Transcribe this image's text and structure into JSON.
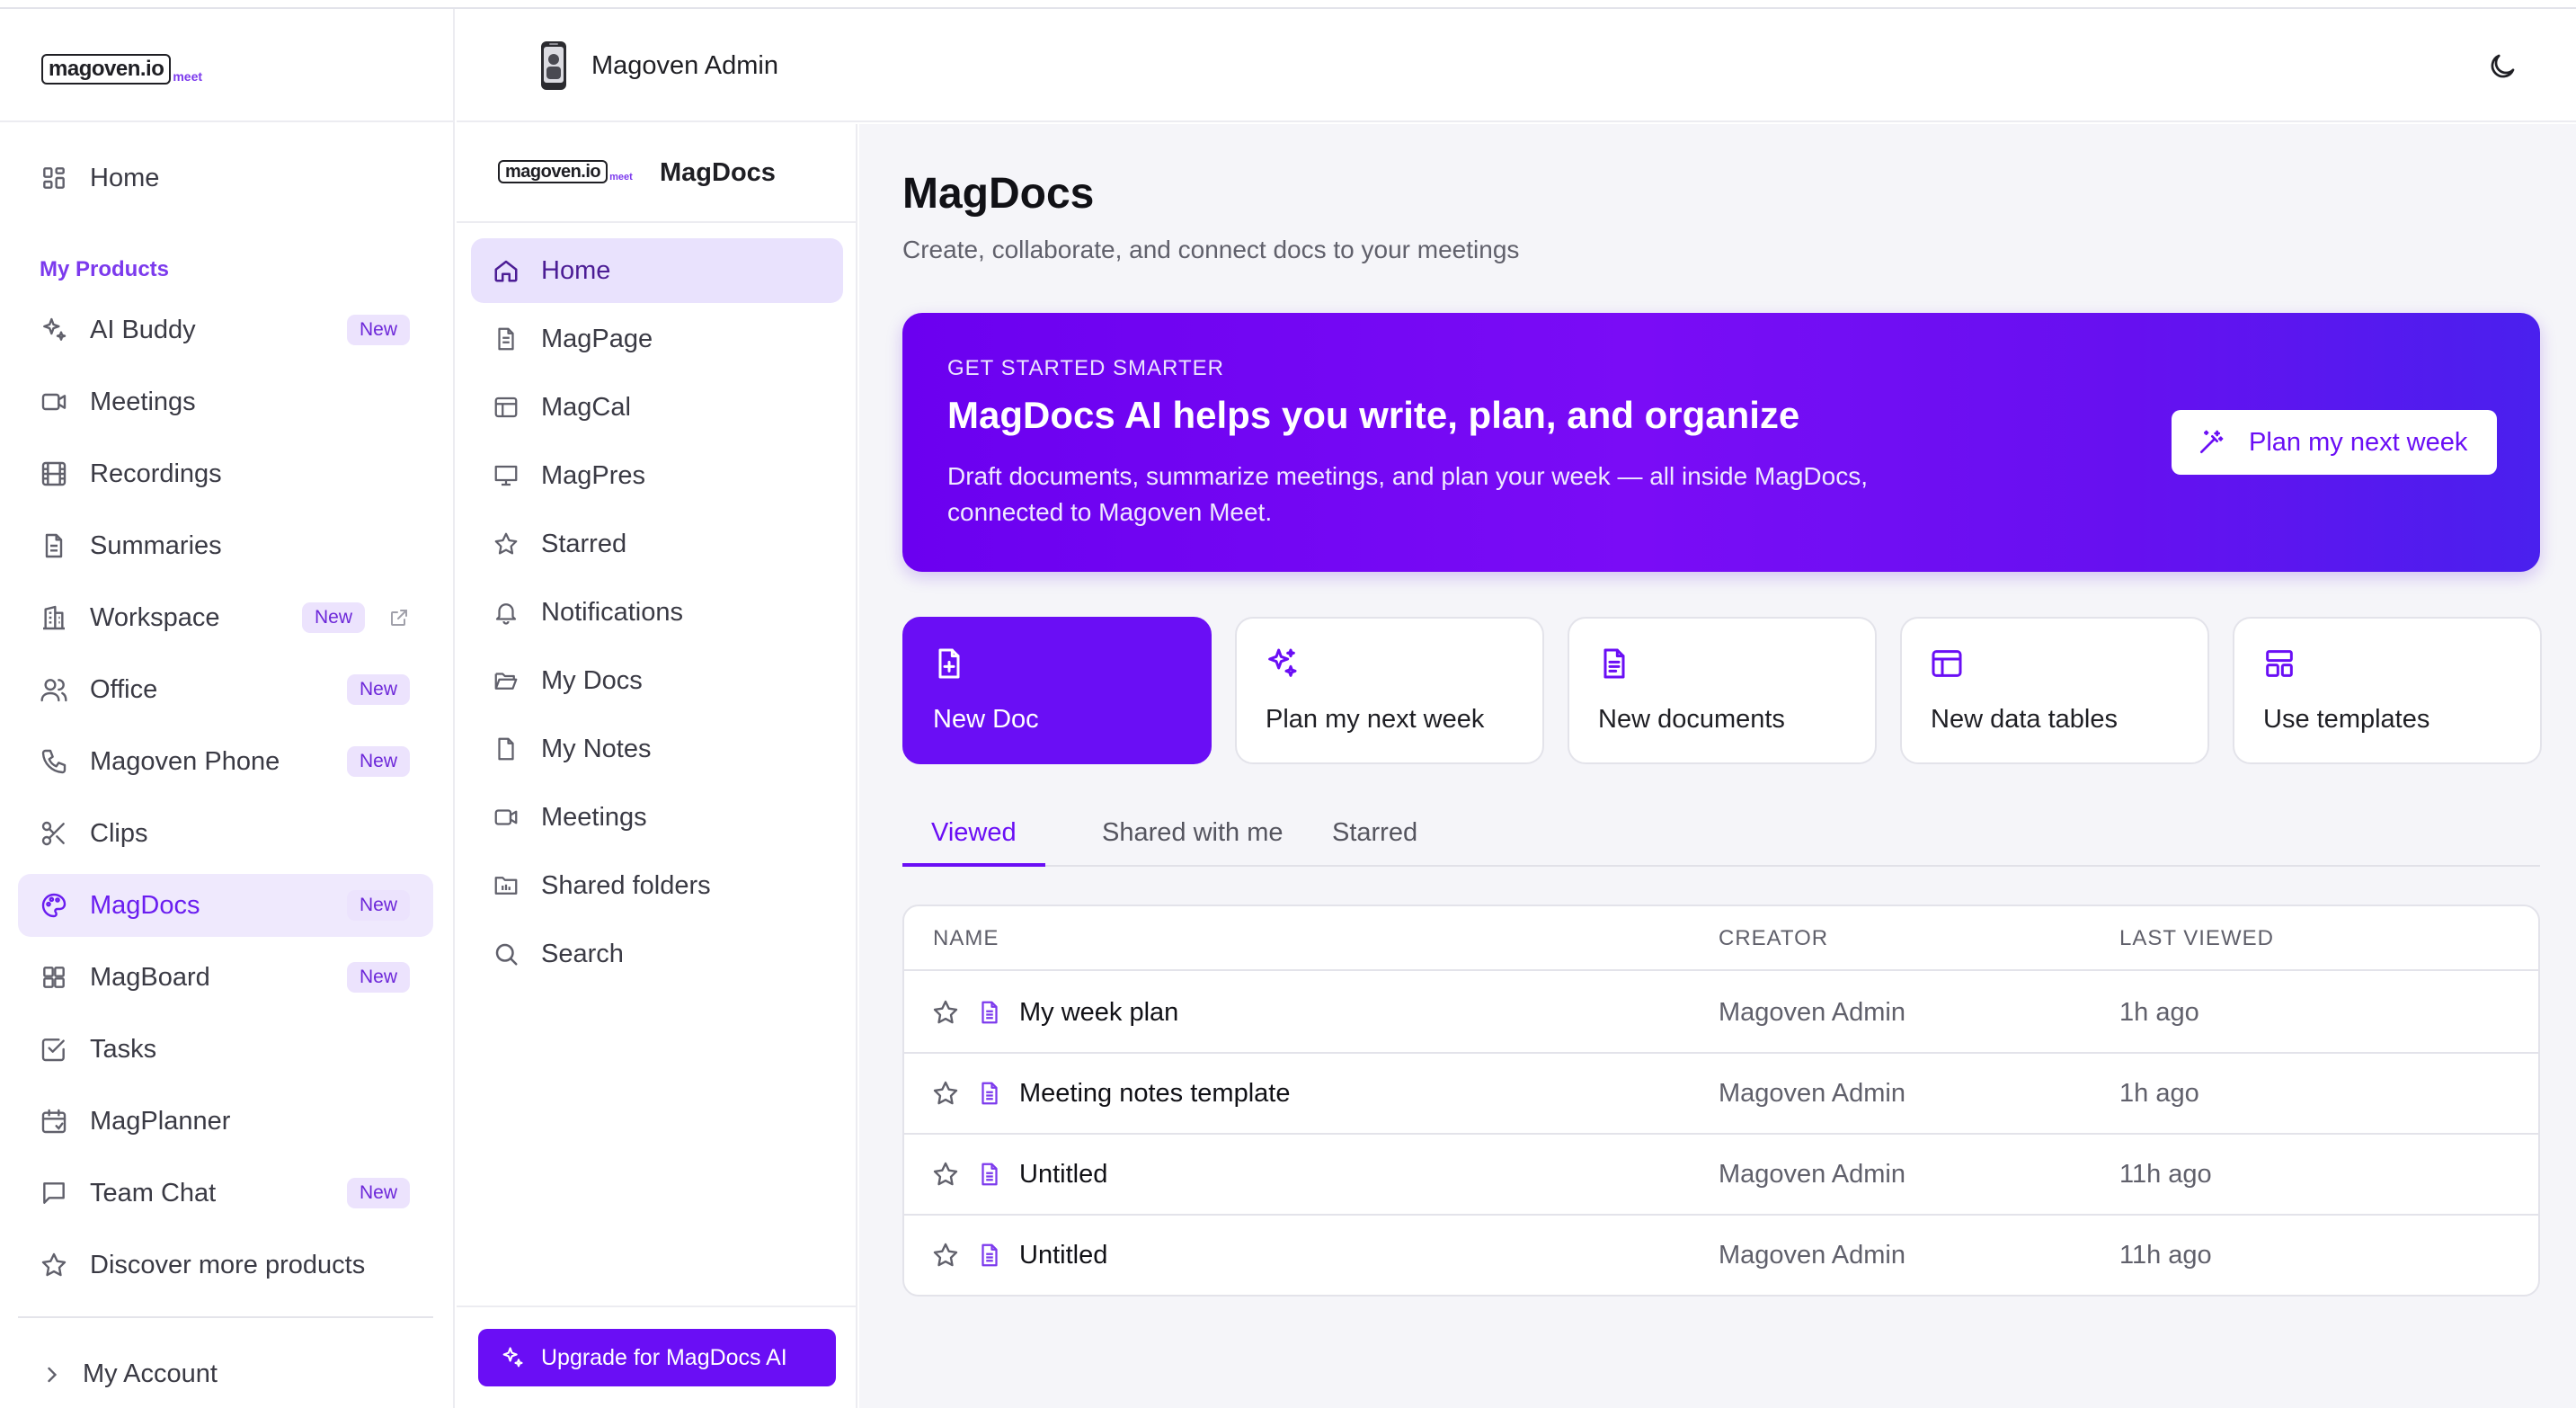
{
  "brand": {
    "logo_text": "magoven.io",
    "logo_suffix": "meet"
  },
  "topbar": {
    "user_name": "Magoven Admin"
  },
  "sidebar": {
    "home_label": "Home",
    "section_title": "My Products",
    "items": [
      {
        "label": "AI Buddy",
        "badge": "New"
      },
      {
        "label": "Meetings",
        "badge": ""
      },
      {
        "label": "Recordings",
        "badge": ""
      },
      {
        "label": "Summaries",
        "badge": ""
      },
      {
        "label": "Workspace",
        "badge": "New"
      },
      {
        "label": "Office",
        "badge": "New"
      },
      {
        "label": "Magoven Phone",
        "badge": "New"
      },
      {
        "label": "Clips",
        "badge": ""
      },
      {
        "label": "MagDocs",
        "badge": "New"
      },
      {
        "label": "MagBoard",
        "badge": "New"
      },
      {
        "label": "Tasks",
        "badge": ""
      },
      {
        "label": "MagPlanner",
        "badge": ""
      },
      {
        "label": "Team Chat",
        "badge": "New"
      },
      {
        "label": "Discover more products",
        "badge": ""
      }
    ],
    "account_label": "My Account"
  },
  "docs_nav": {
    "title": "MagDocs",
    "items": [
      {
        "label": "Home"
      },
      {
        "label": "MagPage"
      },
      {
        "label": "MagCal"
      },
      {
        "label": "MagPres"
      },
      {
        "label": "Starred"
      },
      {
        "label": "Notifications"
      },
      {
        "label": "My Docs"
      },
      {
        "label": "My Notes"
      },
      {
        "label": "Meetings"
      },
      {
        "label": "Shared folders"
      },
      {
        "label": "Search"
      }
    ],
    "upgrade_label": "Upgrade for MagDocs AI"
  },
  "main": {
    "title": "MagDocs",
    "subtitle": "Create, collaborate, and connect docs to your meetings",
    "banner": {
      "kicker": "GET STARTED SMARTER",
      "title": "MagDocs AI helps you write, plan, and organize",
      "description": "Draft documents, summarize meetings, and plan your week — all inside MagDocs, connected to Magoven Meet.",
      "button_label": "Plan my next week"
    },
    "cards": [
      {
        "label": "New Doc",
        "icon": "file-plus-icon"
      },
      {
        "label": "Plan my next week",
        "icon": "sparkles-icon"
      },
      {
        "label": "New documents",
        "icon": "file-text-icon"
      },
      {
        "label": "New data tables",
        "icon": "table-icon"
      },
      {
        "label": "Use templates",
        "icon": "template-icon"
      }
    ],
    "tabs": [
      {
        "label": "Viewed"
      },
      {
        "label": "Shared with me"
      },
      {
        "label": "Starred"
      }
    ],
    "table": {
      "columns": [
        "NAME",
        "CREATOR",
        "LAST VIEWED"
      ],
      "rows": [
        {
          "name": "My week plan",
          "creator": "Magoven Admin",
          "last_viewed": "1h ago"
        },
        {
          "name": "Meeting notes template",
          "creator": "Magoven Admin",
          "last_viewed": "1h ago"
        },
        {
          "name": "Untitled",
          "creator": "Magoven Admin",
          "last_viewed": "11h ago"
        },
        {
          "name": "Untitled",
          "creator": "Magoven Admin",
          "last_viewed": "11h ago"
        }
      ]
    }
  },
  "colors": {
    "accent": "#6a0ef5",
    "badge_bg": "#ece3fd",
    "page_bg": "#f5f5f9"
  }
}
